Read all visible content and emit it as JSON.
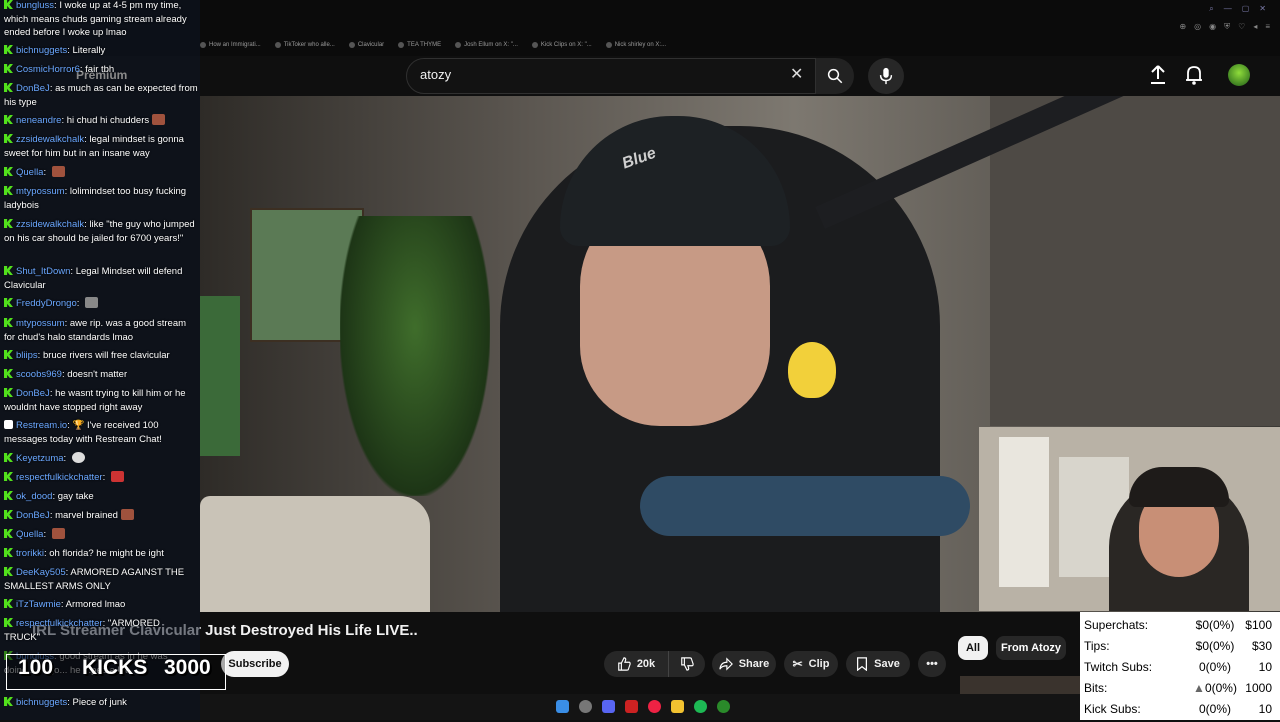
{
  "browser": {
    "bookmarks": [
      "How an Immigrati...",
      "TikToker who alle...",
      "Clavicular",
      "TEA THYME",
      "Josh Ellum on X: \"...",
      "Kick Clips on X: \"...",
      "Nick shirley on X:..."
    ]
  },
  "youtube": {
    "search_query": "atozy",
    "premium_logo": "Premium",
    "video_title": "IRL Streamer Clavicular Just Destroyed His Life LIVE..",
    "subscribe_label": "Subscribe",
    "likes": "20k",
    "share_label": "Share",
    "clip_label": "Clip",
    "save_label": "Save",
    "chips": [
      "All",
      "From Atozy"
    ],
    "mic_brand": "Blue"
  },
  "chat": {
    "messages": [
      {
        "user": "bungluss",
        "text": "I woke up at 4-5 pm my time, which means chuds gaming stream already ended before I woke up lmao"
      },
      {
        "user": "bichnuggets",
        "text": "Literally"
      },
      {
        "user": "CosmicHorror6",
        "text": "fair tbh"
      },
      {
        "user": "DonBeJ",
        "text": "as much as can be expected from his type"
      },
      {
        "user": "neneandre",
        "text": "hi chud hi chudders"
      },
      {
        "user": "zzsidewalkchalk",
        "text": "legal mindset is gonna sweet for him but in an insane way"
      },
      {
        "user": "Quella",
        "text": ""
      },
      {
        "user": "mtypossum",
        "text": "lolimindset too busy fucking ladybois"
      },
      {
        "user": "zzsidewalkchalk",
        "text": "like \"the guy who jumped on his car should be jailed for 6700 years!\""
      },
      {
        "user": "Shut_ItDown",
        "text": "Legal Mindset will defend Clavicular"
      },
      {
        "user": "FreddyDrongo",
        "text": ""
      },
      {
        "user": "mtypossum",
        "text": "awe rip. was a good stream for chud's halo standards lmao"
      },
      {
        "user": "bliips",
        "text": "bruce rivers will free clavicular"
      },
      {
        "user": "scoobs969",
        "text": "doesn't matter"
      },
      {
        "user": "DonBeJ",
        "text": "he wasnt trying to kill him or he wouldnt have stopped right away"
      },
      {
        "user": "Restream.io",
        "text": "🏆 I've received 100 messages today with Restream Chat!"
      },
      {
        "user": "Keyetzuma",
        "text": ""
      },
      {
        "user": "respectfulkickchatter",
        "text": ""
      },
      {
        "user": "ok_dood",
        "text": "gay take"
      },
      {
        "user": "DonBeJ",
        "text": "marvel brained"
      },
      {
        "user": "Quella",
        "text": ""
      },
      {
        "user": "trorikki",
        "text": "oh florida? he might be ight"
      },
      {
        "user": "DeeKay505",
        "text": "ARMORED AGAINST THE SMALLEST ARMS ONLY"
      },
      {
        "user": "iTzTawmie",
        "text": "Armored lmao"
      },
      {
        "user": "respectfulkickchatter",
        "text": "\"ARMORED TRUCK\""
      },
      {
        "user": "bungluss",
        "text": "good stream as in he was doing... or go... he ...ped a lot"
      },
      {
        "user": "bichnuggets",
        "text": "Piece of junk"
      }
    ]
  },
  "kicks_overlay": {
    "current": "100",
    "label": "KICKS",
    "goal": "3000"
  },
  "stats_panel": {
    "rows": [
      {
        "label": "Superchats:",
        "value": "$0(0%)",
        "goal": "$100"
      },
      {
        "label": "Tips:",
        "value": "$0(0%)",
        "goal": "$30"
      },
      {
        "label": "Twitch Subs:",
        "value": "0(0%)",
        "goal": "10"
      },
      {
        "label": "Bits:",
        "value": "0(0%)",
        "goal": "1000"
      },
      {
        "label": "Kick Subs:",
        "value": "0(0%)",
        "goal": "10"
      }
    ]
  },
  "colors": {
    "kick_green": "#52e01c",
    "chat_username": "#6aa7ff",
    "yt_dark": "#0f0f0f"
  }
}
